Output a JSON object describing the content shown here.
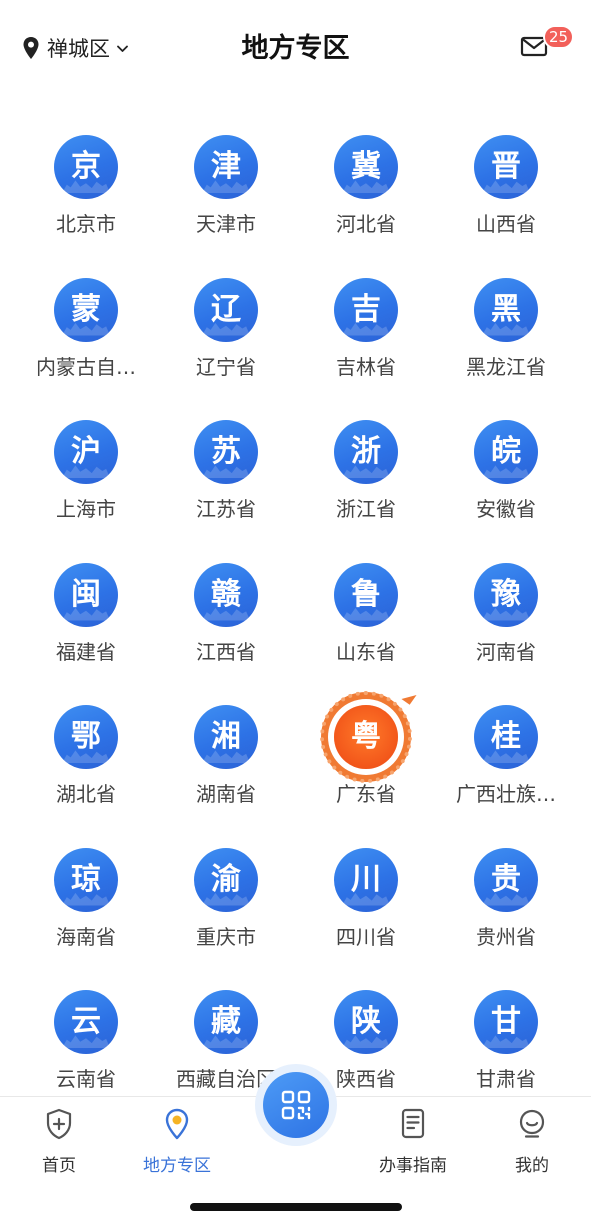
{
  "header": {
    "location": "禅城区",
    "title": "地方专区",
    "mail_badge": "25"
  },
  "regions": [
    {
      "glyph": "京",
      "name": "北京市"
    },
    {
      "glyph": "津",
      "name": "天津市"
    },
    {
      "glyph": "冀",
      "name": "河北省"
    },
    {
      "glyph": "晋",
      "name": "山西省"
    },
    {
      "glyph": "蒙",
      "name": "内蒙古自…"
    },
    {
      "glyph": "辽",
      "name": "辽宁省"
    },
    {
      "glyph": "吉",
      "name": "吉林省"
    },
    {
      "glyph": "黑",
      "name": "黑龙江省"
    },
    {
      "glyph": "沪",
      "name": "上海市"
    },
    {
      "glyph": "苏",
      "name": "江苏省"
    },
    {
      "glyph": "浙",
      "name": "浙江省"
    },
    {
      "glyph": "皖",
      "name": "安徽省"
    },
    {
      "glyph": "闽",
      "name": "福建省"
    },
    {
      "glyph": "赣",
      "name": "江西省"
    },
    {
      "glyph": "鲁",
      "name": "山东省"
    },
    {
      "glyph": "豫",
      "name": "河南省"
    },
    {
      "glyph": "鄂",
      "name": "湖北省"
    },
    {
      "glyph": "湘",
      "name": "湖南省"
    },
    {
      "glyph": "粤",
      "name": "广东省",
      "highlighted": true
    },
    {
      "glyph": "桂",
      "name": "广西壮族…"
    },
    {
      "glyph": "琼",
      "name": "海南省"
    },
    {
      "glyph": "渝",
      "name": "重庆市"
    },
    {
      "glyph": "川",
      "name": "四川省"
    },
    {
      "glyph": "贵",
      "name": "贵州省"
    },
    {
      "glyph": "云",
      "name": "云南省"
    },
    {
      "glyph": "藏",
      "name": "西藏自治区"
    },
    {
      "glyph": "陕",
      "name": "陕西省"
    },
    {
      "glyph": "甘",
      "name": "甘肃省"
    }
  ],
  "tabs": {
    "home": "首页",
    "local": "地方专区",
    "guide": "办事指南",
    "mine": "我的"
  },
  "colors": {
    "accent": "#3a73d8",
    "badge": "#f2605a",
    "highlight": "#f2561a"
  },
  "icons": {
    "location": "location-pin-icon",
    "dropdown": "chevron-down-icon",
    "mail": "mail-icon",
    "home": "shield-plus-icon",
    "local": "map-pin-icon",
    "scan": "qr-scan-icon",
    "guide": "document-icon",
    "mine": "smiley-face-icon"
  }
}
